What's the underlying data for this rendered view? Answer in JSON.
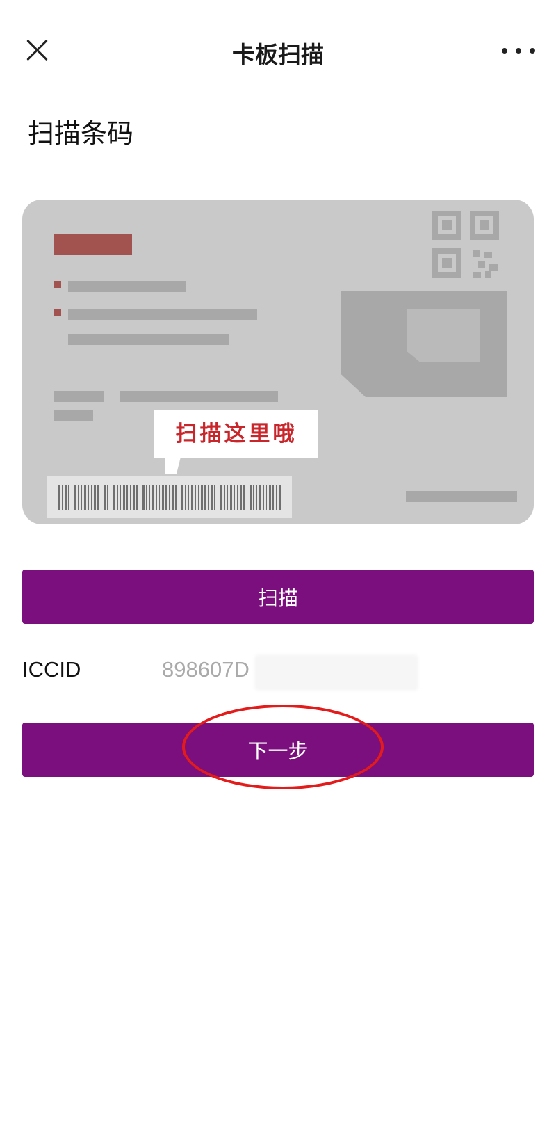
{
  "header": {
    "title": "卡板扫描",
    "close_icon": "close-icon",
    "more_icon": "more-icon"
  },
  "section": {
    "title": "扫描条码"
  },
  "illustration": {
    "hint": "扫描这里哦",
    "colors": {
      "card": "#c8c9c8",
      "accent_red": "#a3534f",
      "hint_text": "#c8262b"
    }
  },
  "scan_button": {
    "label": "扫描"
  },
  "iccid": {
    "label": "ICCID",
    "value": "898607D"
  },
  "next_button": {
    "label": "下一步"
  },
  "theme": {
    "primary": "#7a0f7d",
    "annotation": "#e31b1b"
  }
}
